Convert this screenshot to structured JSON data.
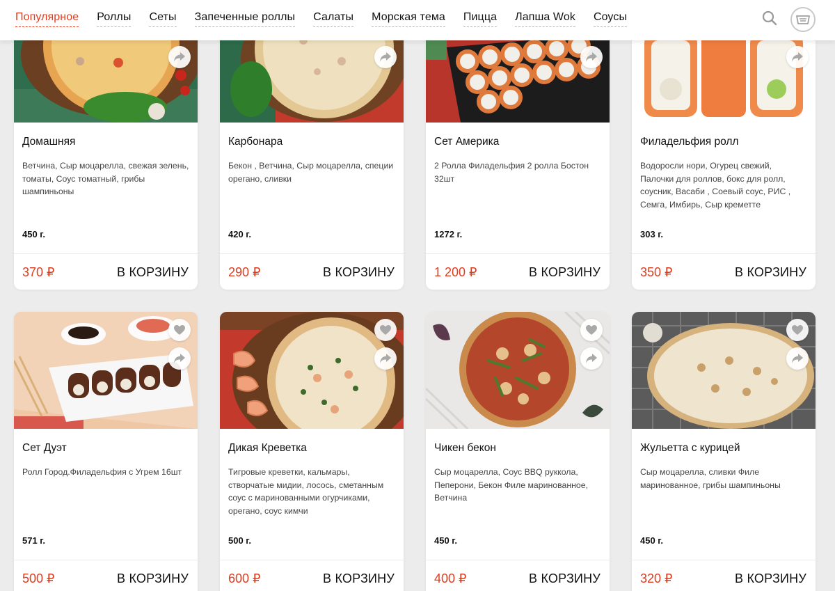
{
  "nav": {
    "items": [
      "Популярное",
      "Роллы",
      "Сеты",
      "Запеченные роллы",
      "Салаты",
      "Морская тема",
      "Пицца",
      "Лапша Wok",
      "Соусы"
    ],
    "active_index": 0
  },
  "colors": {
    "accent": "#e23c1e",
    "background": "#ececec",
    "card": "#ffffff"
  },
  "icons": {
    "search": "search-icon",
    "cart": "cart-icon",
    "favorite": "heart-icon",
    "share": "share-icon"
  },
  "products": [
    {
      "name": "Домашняя",
      "description": "Ветчина, Сыр моцарелла, свежая зелень, томаты, Соус томатный, грибы шампиньоны",
      "weight": "450 г.",
      "price": "370 ₽",
      "cart_label": "В КОРЗИНУ"
    },
    {
      "name": "Карбонара",
      "description": "Бекон , Ветчина, Сыр моцарелла, специи орегано, сливки",
      "weight": "420 г.",
      "price": "290 ₽",
      "cart_label": "В КОРЗИНУ"
    },
    {
      "name": "Сет Америка",
      "description": "2 Ролла Филадельфия 2 ролла Бостон 32шт",
      "weight": "1272 г.",
      "price": "1 200 ₽",
      "cart_label": "В КОРЗИНУ"
    },
    {
      "name": "Филадельфия ролл",
      "description": "Водоросли нори, Огурец свежий, Палочки для роллов, бокс для ролл, соусник, Васаби , Соевый соус, РИС , Семга, Имбирь, Сыр креметте",
      "weight": "303 г.",
      "price": "350 ₽",
      "cart_label": "В КОРЗИНУ"
    },
    {
      "name": "Сет Дуэт",
      "description": "Ролл Город.Филадельфия с Угрем 16шт",
      "weight": "571 г.",
      "price": "500 ₽",
      "cart_label": "В КОРЗИНУ"
    },
    {
      "name": "Дикая Креветка",
      "description": "Тигровые креветки, кальмары, створчатые мидии, лосось, сметанным соус с маринованными огурчиками, орегано, соус кимчи",
      "weight": "500 г.",
      "price": "600 ₽",
      "cart_label": "В КОРЗИНУ"
    },
    {
      "name": "Чикен бекон",
      "description": "Сыр моцарелла, Соус BBQ руккола, Пеперони, Бекон Филе маринованное, Ветчина",
      "weight": "450 г.",
      "price": "400 ₽",
      "cart_label": "В КОРЗИНУ"
    },
    {
      "name": "Жульетта с курицей",
      "description": "Сыр моцарелла, сливки Филе маринованное, грибы шампиньоны",
      "weight": "450 г.",
      "price": "320 ₽",
      "cart_label": "В КОРЗИНУ"
    }
  ]
}
